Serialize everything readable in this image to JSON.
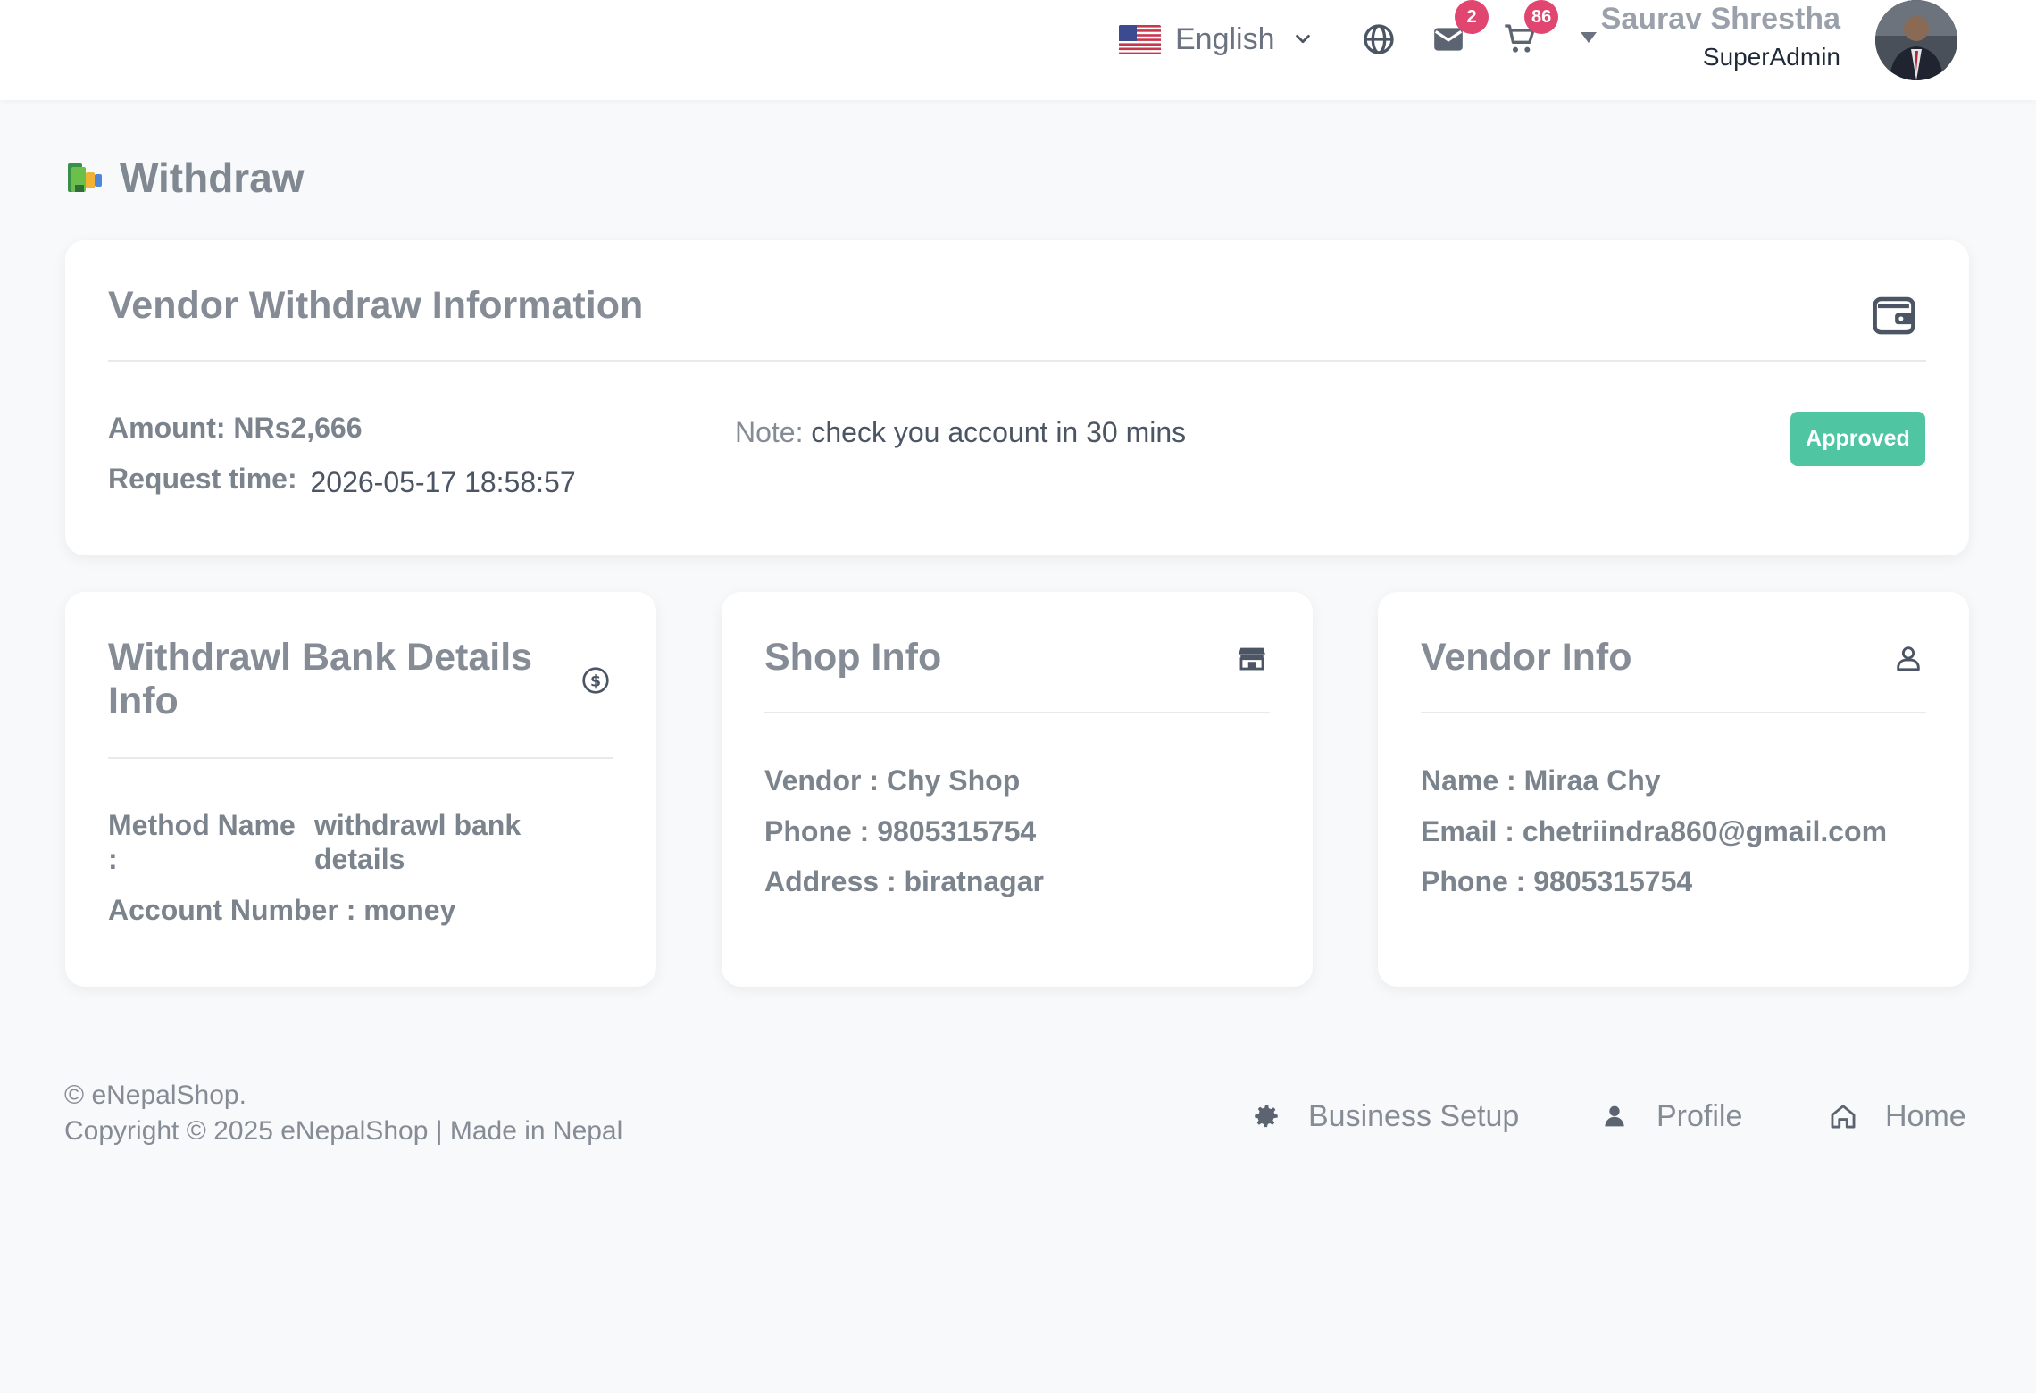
{
  "header": {
    "language": "English",
    "messages_badge": "2",
    "cart_badge": "86",
    "user_name": "Saurav Shrestha",
    "user_role": "SuperAdmin"
  },
  "page": {
    "title": "Withdraw"
  },
  "withdraw_info": {
    "title": "Vendor Withdraw Information",
    "amount_label": "Amount:",
    "amount_value": "NRs2,666",
    "request_time_label": "Request time:",
    "request_time_value": "2026-05-17 18:58:57",
    "note_label": "Note:",
    "note_value": "check you account in 30 mins",
    "status": "Approved"
  },
  "bank_details": {
    "title_line1": "Withdrawl Bank Details",
    "title_line2": "Info",
    "method_label_line1": "Method Name",
    "method_label_line2": ":",
    "method_value_line1": "withdrawl bank",
    "method_value_line2": "details",
    "account_label": "Account Number :",
    "account_value": "money"
  },
  "shop_info": {
    "title": "Shop Info",
    "vendor_label": "Vendor :",
    "vendor_value": "Chy Shop",
    "phone_label": "Phone :",
    "phone_value": "9805315754",
    "address_label": "Address :",
    "address_value": "biratnagar"
  },
  "vendor_info": {
    "title": "Vendor Info",
    "name_label": "Name :",
    "name_value": "Miraa Chy",
    "email_label": "Email :",
    "email_value": "chetriindra860@gmail.com",
    "phone_label": "Phone :",
    "phone_value": "9805315754"
  },
  "footer": {
    "brand": "© eNepalShop.",
    "copyright": "Copyright © 2025 eNepalShop | Made in Nepal",
    "links": [
      "Business Setup",
      "Profile",
      "Home"
    ]
  },
  "colors": {
    "badge": "#e0466f",
    "approved": "#4fc5a1",
    "background": "#f8f9fb"
  },
  "icons": {
    "language": "us-flag-icon",
    "globe": "globe-icon",
    "messages": "envelope-icon",
    "cart": "cart-icon",
    "withdraw_card": "wallet-icon",
    "bank_card": "dollar-circle-icon",
    "shop_card": "store-icon",
    "vendor_card": "user-icon"
  }
}
